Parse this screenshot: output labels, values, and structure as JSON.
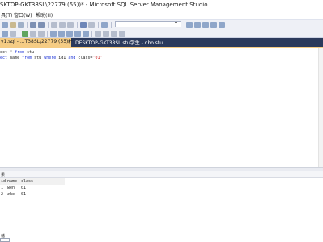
{
  "window": {
    "title": "SKTOP-GKT38SL\\22779 (55))* - Microsoft SQL Server Management Studio"
  },
  "menu": {
    "items": [
      "具(T)",
      "窗口(W)",
      "帮助(H)"
    ]
  },
  "tabs": [
    {
      "label": "y1.sql - ...T38SL\\22779 (55))*",
      "close": "×"
    },
    {
      "label": "DESKTOP-GKT38SL.stu学生 - dbo.stu"
    }
  ],
  "editor": {
    "line1": {
      "pre": "ect * ",
      "kw1": "from",
      "post": " stu"
    },
    "line2": {
      "kw1": "ect",
      "a": " name ",
      "kw2": "from",
      "b": " stu ",
      "kw3": "where",
      "c": " id",
      "d": "1 ",
      "kw4": "and",
      "e": " class",
      "f": "=",
      "str": "'01'"
    }
  },
  "results": {
    "tab_label": "果",
    "columns": [
      "id",
      "name",
      "class"
    ],
    "rows": [
      {
        "id": "1",
        "name": "wen",
        "class": "01"
      },
      {
        "id": "2",
        "name": "zhe",
        "class": "01"
      }
    ]
  },
  "statusbar": {
    "text": "绪"
  },
  "colors": {
    "tab_active": "#f5cc84",
    "tab_strip": "#2b3a5c",
    "keyword": "#1b32d6",
    "string": "#c81e1e"
  }
}
